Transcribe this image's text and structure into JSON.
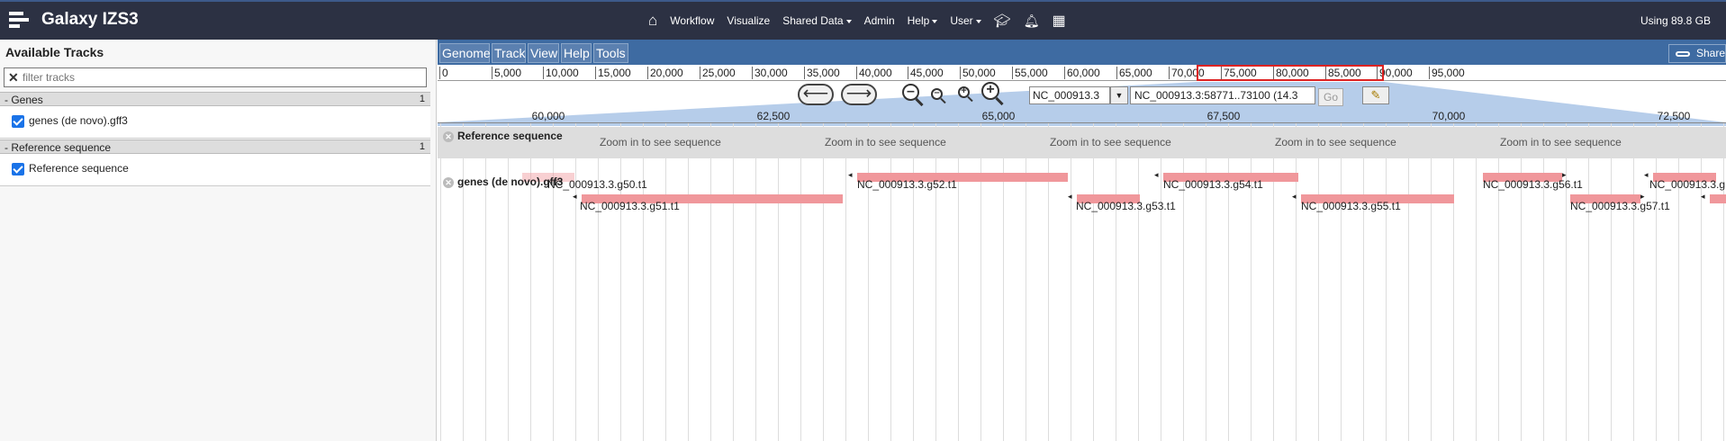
{
  "topbar": {
    "brand": "Galaxy IZS3",
    "nav": [
      "Workflow",
      "Visualize",
      "Shared Data",
      "Admin",
      "Help",
      "User"
    ],
    "usage": "Using 89.8 GB"
  },
  "sidebar": {
    "title": "Available Tracks",
    "filter_placeholder": "filter tracks",
    "categories": [
      {
        "name": "Genes",
        "count": "1",
        "track": "genes (de novo).gff3"
      },
      {
        "name": "Reference sequence",
        "count": "1",
        "track": "Reference sequence"
      }
    ]
  },
  "menubar": {
    "items": [
      "Genome",
      "Track",
      "View",
      "Help",
      "Tools"
    ],
    "share": "Share"
  },
  "overview": {
    "ticks": [
      "0",
      "5,000",
      "10,000",
      "15,000",
      "20,000",
      "25,000",
      "30,000",
      "35,000",
      "40,000",
      "45,000",
      "50,000",
      "55,000",
      "60,000",
      "65,000",
      "70,000",
      "75,000",
      "80,000",
      "85,000",
      "90,000",
      "95,000"
    ]
  },
  "location": {
    "refseq": "NC_000913.3",
    "locus": "NC_000913.3:58771..73100 (14.3",
    "go": "Go"
  },
  "detail_scale": [
    "60,000",
    "62,500",
    "65,000",
    "67,500",
    "70,000",
    "72,500"
  ],
  "tracks": {
    "reference": {
      "label": "Reference sequence",
      "zoom_text": "Zoom in to see sequence"
    },
    "genes": {
      "label": "genes (de novo).gff3"
    }
  },
  "features": {
    "row1": [
      "NC_000913.3.g50.t1",
      "NC_000913.3.g52.t1",
      "NC_000913.3.g54.t1",
      "NC_000913.3.g56.t1",
      "NC_000913.3.g"
    ],
    "row2": [
      "NC_000913.3.g51.t1",
      "NC_000913.3.g53.t1",
      "NC_000913.3.g55.t1",
      "NC_000913.3.g57.t1"
    ]
  },
  "colors": {
    "topbar": "#2c3143",
    "menubar": "#3e6ba2",
    "feature": "#f0979b",
    "highlight": "#dd2222"
  }
}
